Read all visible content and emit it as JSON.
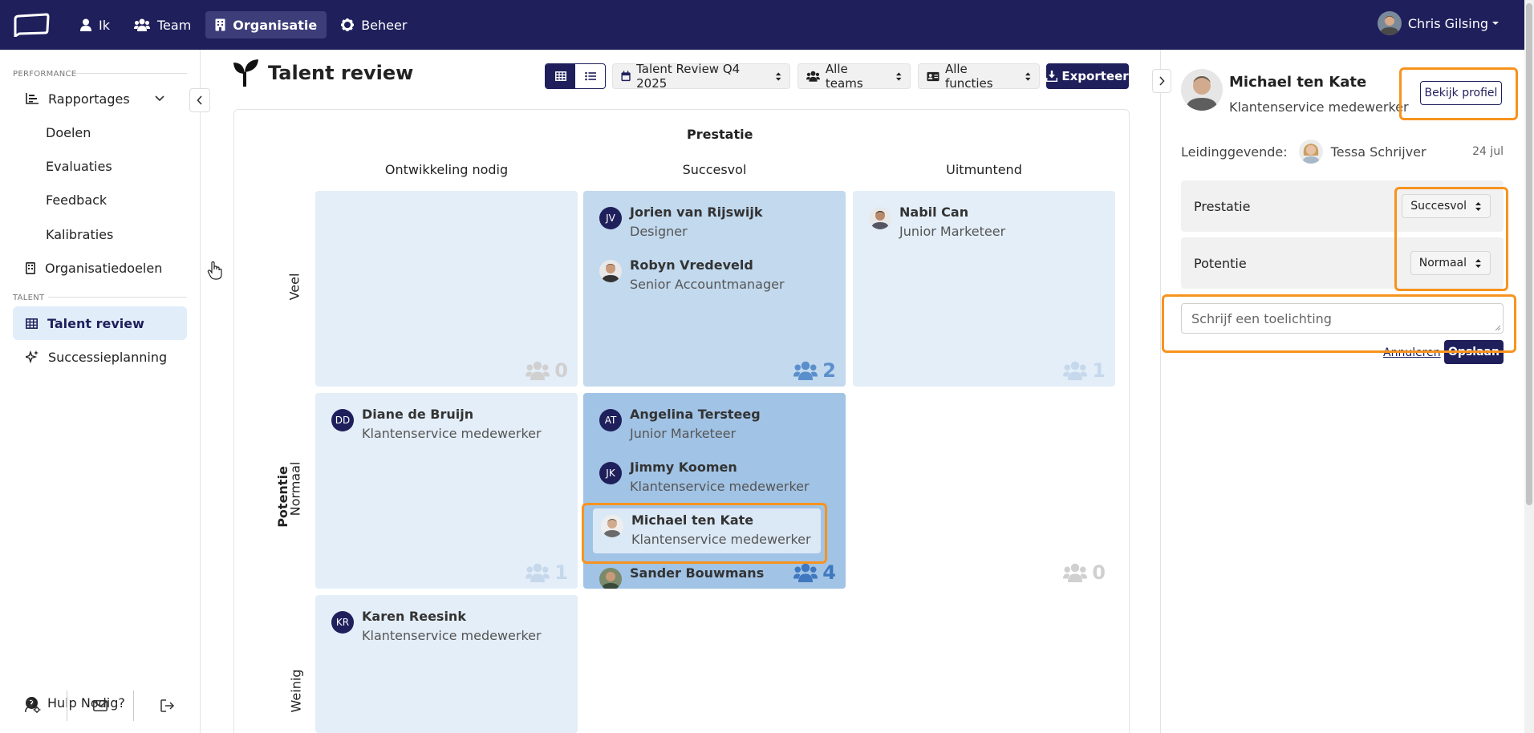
{
  "nav": {
    "items": [
      {
        "label": "Ik",
        "icon": "user-icon"
      },
      {
        "label": "Team",
        "icon": "users-icon"
      },
      {
        "label": "Organisatie",
        "icon": "building-icon",
        "active": true
      },
      {
        "label": "Beheer",
        "icon": "gear-icon"
      }
    ],
    "user_name": "Chris Gilsing"
  },
  "sidebar": {
    "section_performance": "PERFORMANCE",
    "section_talent": "TALENT",
    "items": [
      {
        "label": "Rapportages",
        "icon": "chart-bar-icon"
      },
      {
        "label": "Doelen"
      },
      {
        "label": "Evaluaties"
      },
      {
        "label": "Feedback"
      },
      {
        "label": "Kalibraties"
      },
      {
        "label": "Organisatiedoelen",
        "icon": "building-icon"
      },
      {
        "label": "Talent review",
        "icon": "grid-icon",
        "active": true
      },
      {
        "label": "Successieplanning",
        "icon": "sparkles-icon"
      }
    ],
    "help": "Hulp Nodig?"
  },
  "page": {
    "title": "Talent review",
    "filters": {
      "review": "Talent Review Q4 2025",
      "teams": "Alle teams",
      "functions": "Alle functies"
    },
    "export_label": "Exporteer"
  },
  "grid": {
    "x_title": "Prestatie",
    "y_title": "Potentie",
    "columns": [
      "Ontwikkeling nodig",
      "Succesvol",
      "Uitmuntend"
    ],
    "rows": [
      "Veel",
      "Normaal",
      "Weinig"
    ],
    "cells": {
      "veel_ontwikkeling": {
        "count": "0",
        "people": []
      },
      "veel_succesvol": {
        "count": "2",
        "people": [
          {
            "initials": "JV",
            "name": "Jorien van Rijswijk",
            "role": "Designer"
          },
          {
            "name": "Robyn Vredeveld",
            "role": "Senior Accountmanager"
          }
        ]
      },
      "veel_uitmuntend": {
        "count": "1",
        "people": [
          {
            "name": "Nabil Can",
            "role": "Junior Marketeer"
          }
        ]
      },
      "normaal_ontwikkeling": {
        "count": "1",
        "people": [
          {
            "initials": "DD",
            "name": "Diane de Bruijn",
            "role": "Klantenservice medewerker"
          }
        ]
      },
      "normaal_succesvol": {
        "count": "4",
        "people": [
          {
            "initials": "AT",
            "name": "Angelina Tersteeg",
            "role": "Junior Marketeer"
          },
          {
            "initials": "JK",
            "name": "Jimmy Koomen",
            "role": "Klantenservice medewerker"
          },
          {
            "name": "Michael ten Kate",
            "role": "Klantenservice medewerker"
          },
          {
            "name": "Sander Bouwmans"
          }
        ]
      },
      "normaal_uitmuntend": {
        "count": "0",
        "people": []
      },
      "weinig_ontwikkeling": {
        "people": [
          {
            "initials": "KR",
            "name": "Karen Reesink",
            "role": "Klantenservice medewerker"
          }
        ]
      }
    }
  },
  "panel": {
    "name": "Michael ten Kate",
    "role": "Klantenservice medewerker",
    "view_profile": "Bekijk profiel",
    "manager_label": "Leidinggevende:",
    "manager_name": "Tessa Schrijver",
    "date": "24 jul",
    "performance_label": "Prestatie",
    "performance_value": "Succesvol",
    "potential_label": "Potentie",
    "potential_value": "Normaal",
    "comment_placeholder": "Schrijf een toelichting",
    "cancel": "Annuleren",
    "save": "Opslaan"
  },
  "colors": {
    "navy": "#1f1f5c",
    "highlight": "#f7931e",
    "cell_light": "#e4eef8",
    "cell_mid": "#c2d9ee",
    "cell_dark": "#a1c3e5"
  }
}
